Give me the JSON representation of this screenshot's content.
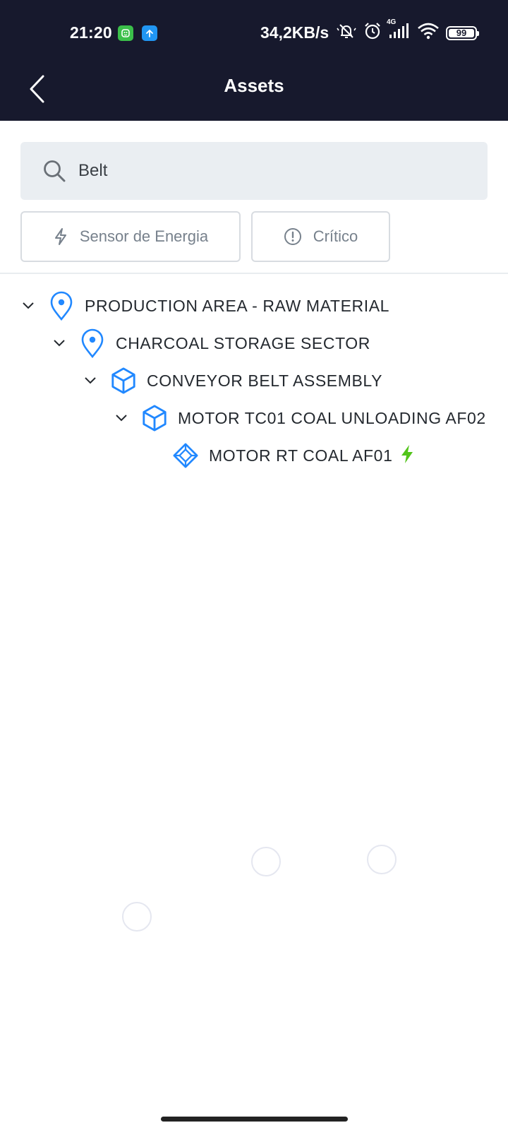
{
  "status_bar": {
    "time": "21:20",
    "network_speed": "34,2KB/s",
    "network_type": "4G",
    "battery": "99",
    "icons": [
      "notification-app-icon",
      "upload-icon",
      "bell-muted-icon",
      "alarm-icon",
      "signal-icon",
      "wifi-icon",
      "battery-icon"
    ]
  },
  "header": {
    "title": "Assets",
    "back_icon": "chevron-left-icon"
  },
  "search": {
    "value": "Belt",
    "icon": "search-icon"
  },
  "filters": [
    {
      "label": "Sensor de Energia",
      "icon": "bolt-outline-icon",
      "active": false
    },
    {
      "label": "Crítico",
      "icon": "alert-circle-icon",
      "active": false
    }
  ],
  "tree": [
    {
      "label": "PRODUCTION AREA - RAW MATERIAL",
      "type": "location",
      "level": 0,
      "expanded": true
    },
    {
      "label": "CHARCOAL STORAGE SECTOR",
      "type": "location",
      "level": 1,
      "expanded": true
    },
    {
      "label": "CONVEYOR BELT ASSEMBLY",
      "type": "asset",
      "level": 2,
      "expanded": true
    },
    {
      "label": "MOTOR TC01 COAL UNLOADING AF02",
      "type": "asset",
      "level": 3,
      "expanded": true
    },
    {
      "label": "MOTOR RT COAL AF01",
      "type": "component",
      "level": 4,
      "sensor": "energy",
      "status": "operating"
    }
  ],
  "colors": {
    "header_bg": "#17192d",
    "accent_blue": "#2188ff",
    "energy_green": "#52c41a",
    "search_bg": "#eaeef2",
    "chip_border": "#d8dce1",
    "chip_text": "#77818c"
  }
}
